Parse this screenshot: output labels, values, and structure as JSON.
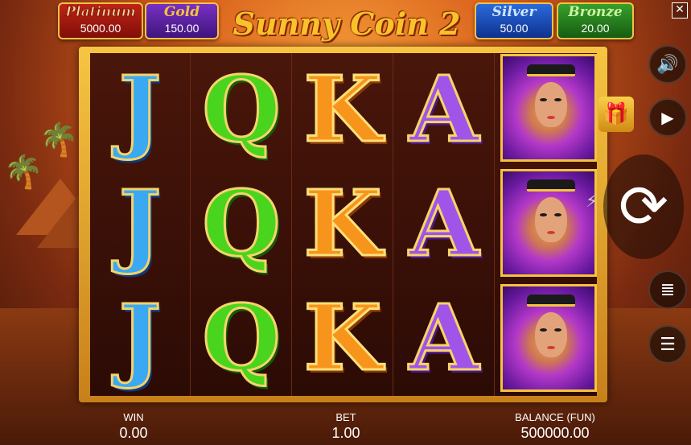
{
  "jackpots": [
    {
      "name": "Platinum",
      "value": "5000.00"
    },
    {
      "name": "Gold",
      "value": "150.00"
    },
    {
      "name": "Silver",
      "value": "50.00"
    },
    {
      "name": "Bronze",
      "value": "20.00"
    }
  ],
  "logo": "Sunny Coin 2",
  "close_label": "✕",
  "reels": [
    [
      "J",
      "J",
      "J"
    ],
    [
      "Q",
      "Q",
      "Q"
    ],
    [
      "K",
      "K",
      "K"
    ],
    [
      "A",
      "A",
      "A"
    ],
    [
      "cleopatra",
      "cleopatra",
      "cleopatra"
    ]
  ],
  "controls": {
    "sound_icon": "🔊",
    "gift_icon": "🎁",
    "autoplay_icon": "▶",
    "spin_icon": "⟳",
    "bolt_icon": "⚡",
    "bet_icon": "≣",
    "menu_icon": "☰"
  },
  "bottom": {
    "win_label": "WIN",
    "win_value": "0.00",
    "bet_label": "BET",
    "bet_value": "1.00",
    "balance_label": "BALANCE (FUN)",
    "balance_value": "500000.00"
  }
}
